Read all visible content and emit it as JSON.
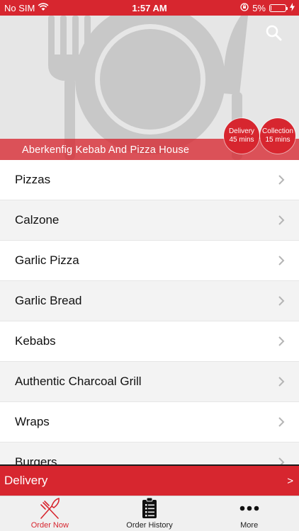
{
  "status_bar": {
    "carrier": "No SIM",
    "time": "1:57 AM",
    "battery_text": "5%",
    "battery_level": 0.05
  },
  "hero": {
    "restaurant_name": "Aberkenfig Kebab And Pizza House",
    "delivery": {
      "label": "Delivery",
      "time": "45 mins"
    },
    "collection": {
      "label": "Collection",
      "time": "15 mins"
    }
  },
  "menu": {
    "items": [
      {
        "label": "Pizzas"
      },
      {
        "label": "Calzone"
      },
      {
        "label": "Garlic Pizza"
      },
      {
        "label": "Garlic Bread"
      },
      {
        "label": "Kebabs"
      },
      {
        "label": "Authentic Charcoal Grill"
      },
      {
        "label": "Wraps"
      },
      {
        "label": "Burgers"
      }
    ]
  },
  "delivery_bar": {
    "label": "Delivery",
    "arrow": ">"
  },
  "tab_bar": {
    "tabs": [
      {
        "label": "Order Now"
      },
      {
        "label": "Order History"
      },
      {
        "label": "More"
      }
    ]
  },
  "colors": {
    "accent": "#d7262f",
    "hero_bg": "#e6e6e6",
    "alt_row": "#f3f3f3"
  },
  "icons": [
    "wifi-icon",
    "lock-rotation-icon",
    "battery-icon",
    "charging-icon",
    "search-icon",
    "chevron-right-icon",
    "fork-knife-icon",
    "clipboard-list-icon",
    "ellipsis-icon"
  ]
}
